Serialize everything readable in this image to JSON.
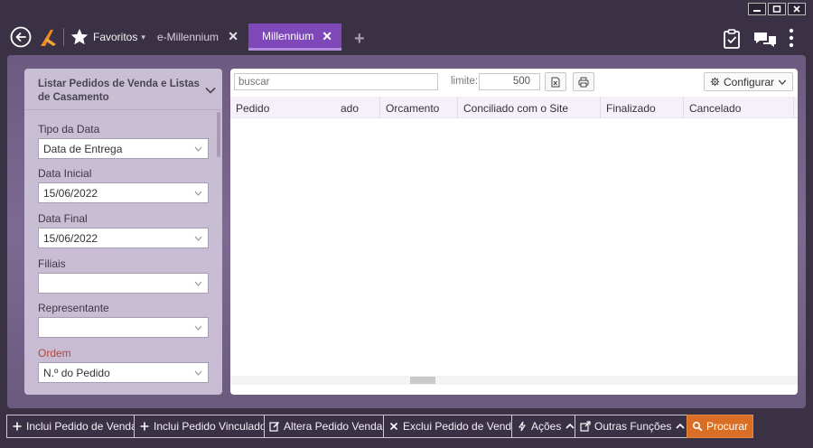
{
  "topbar": {
    "favorites_label": "Favoritos",
    "favorites_caret": "▾",
    "tabs": [
      {
        "label": "e-Millennium",
        "close": "✕"
      },
      {
        "label": "Millennium",
        "close": "✕"
      }
    ],
    "add_tab": "+",
    "accent_color": "#7e48b9",
    "icons": [
      "back-arrow-icon",
      "logo-icon",
      "star-icon",
      "clipboard-check-icon",
      "chat-icon",
      "more-vertical-icon"
    ]
  },
  "filters": {
    "title": "Listar Pedidos de Venda e Listas de Casamento",
    "fields": [
      {
        "label": "Tipo da Data",
        "value": "Data de Entrega"
      },
      {
        "label": "Data Inicial",
        "value": "15/06/2022"
      },
      {
        "label": "Data Final",
        "value": "15/06/2022"
      },
      {
        "label": "Filiais",
        "value": ""
      },
      {
        "label": "Representante",
        "value": ""
      },
      {
        "label": "Ordem",
        "value": "N.º do Pedido"
      }
    ]
  },
  "grid": {
    "search_placeholder": "buscar",
    "limit_label": "limite:",
    "limit_value": "500",
    "config_label": "Configurar",
    "columns": [
      "Pedido",
      "ado",
      "Orcamento",
      "Conciliado com o Site",
      "Finalizado",
      "Cancelado"
    ]
  },
  "actions": [
    {
      "label": "Inclui Pedido de Venda",
      "icon": "plus-icon"
    },
    {
      "label": "Inclui Pedido Vinculado",
      "icon": "plus-icon"
    },
    {
      "label": "Altera Pedido Venda",
      "icon": "edit-icon"
    },
    {
      "label": "Exclui Pedido de Venda",
      "icon": "x-icon"
    },
    {
      "label": "Ações",
      "icon": "bolt-icon"
    },
    {
      "label": "Outras Funções",
      "icon": "external-icon"
    },
    {
      "label": "Procurar",
      "icon": "search-icon",
      "color": "#d86f24"
    }
  ]
}
